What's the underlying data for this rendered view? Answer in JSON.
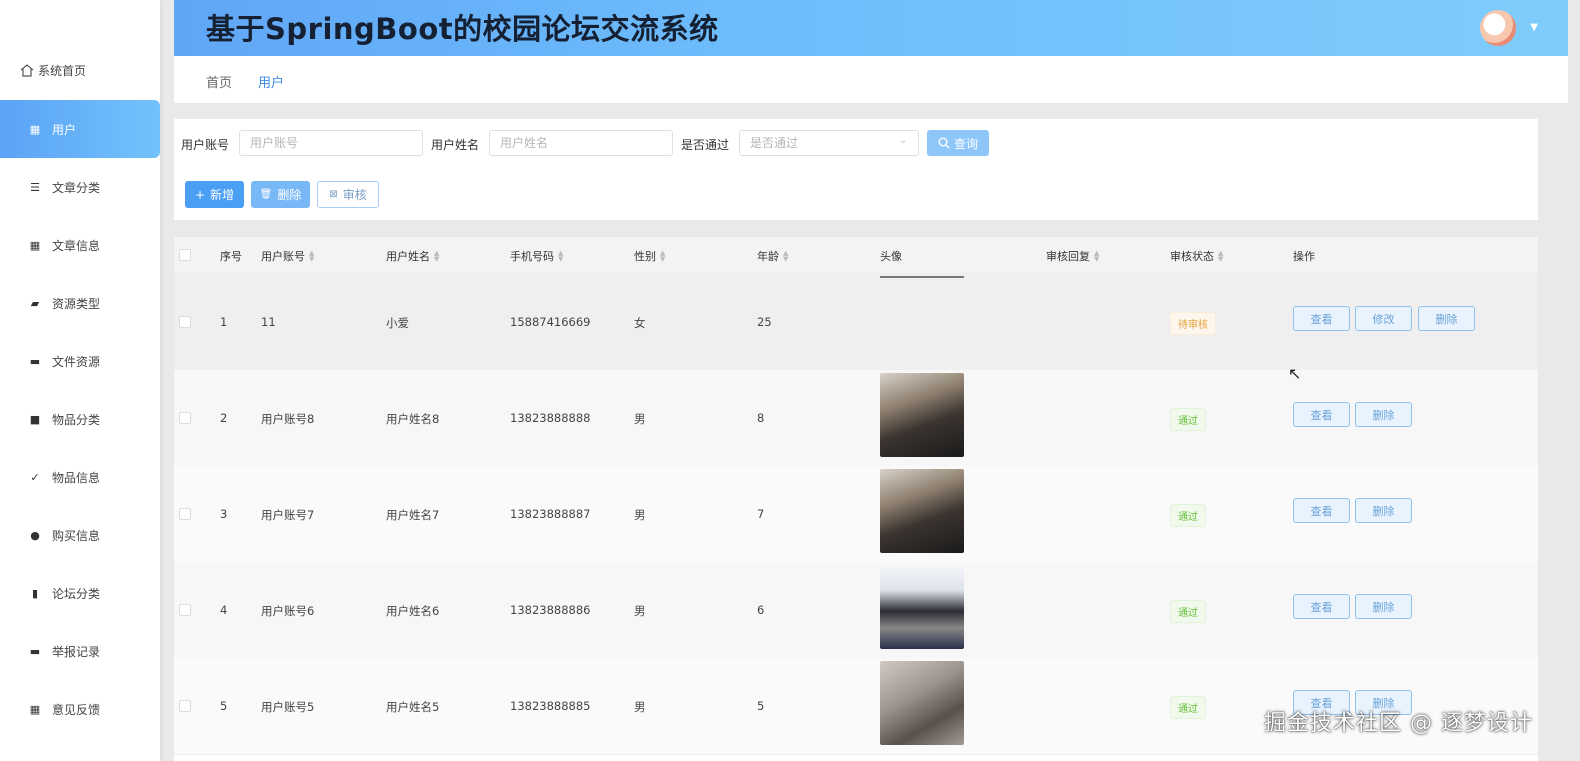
{
  "header": {
    "title": "基于SpringBoot的校园论坛交流系统"
  },
  "sidebar": {
    "home": "系统首页",
    "items": [
      {
        "label": "用户",
        "icon": "grid-icon"
      },
      {
        "label": "文章分类",
        "icon": "list-icon"
      },
      {
        "label": "文章信息",
        "icon": "grid-icon"
      },
      {
        "label": "资源类型",
        "icon": "wallet-icon"
      },
      {
        "label": "文件资源",
        "icon": "monitor-icon"
      },
      {
        "label": "物品分类",
        "icon": "message-icon"
      },
      {
        "label": "物品信息",
        "icon": "clipboard-icon"
      },
      {
        "label": "购买信息",
        "icon": "user-icon"
      },
      {
        "label": "论坛分类",
        "icon": "bar-chart-icon"
      },
      {
        "label": "举报记录",
        "icon": "monitor-icon"
      },
      {
        "label": "意见反馈",
        "icon": "grid-icon"
      }
    ]
  },
  "breadcrumb": {
    "home": "首页",
    "current": "用户"
  },
  "filters": {
    "account_label": "用户账号",
    "account_placeholder": "用户账号",
    "name_label": "用户姓名",
    "name_placeholder": "用户姓名",
    "pass_label": "是否通过",
    "pass_placeholder": "是否通过",
    "query": "查询"
  },
  "actions": {
    "add": "新增",
    "delete": "删除",
    "audit": "审核"
  },
  "table": {
    "headers": [
      "序号",
      "用户账号",
      "用户姓名",
      "手机号码",
      "性别",
      "年龄",
      "头像",
      "审核回复",
      "审核状态",
      "操作"
    ],
    "rows": [
      {
        "idx": "1",
        "account": "11",
        "name": "小爱",
        "phone": "15887416669",
        "gender": "女",
        "age": "25",
        "status": "待审核",
        "btns": [
          "查看",
          "修改",
          "删除"
        ]
      },
      {
        "idx": "2",
        "account": "用户账号8",
        "name": "用户姓名8",
        "phone": "13823888888",
        "gender": "男",
        "age": "8",
        "status": "通过",
        "btns": [
          "查看",
          "删除"
        ]
      },
      {
        "idx": "3",
        "account": "用户账号7",
        "name": "用户姓名7",
        "phone": "13823888887",
        "gender": "男",
        "age": "7",
        "status": "通过",
        "btns": [
          "查看",
          "删除"
        ]
      },
      {
        "idx": "4",
        "account": "用户账号6",
        "name": "用户姓名6",
        "phone": "13823888886",
        "gender": "男",
        "age": "6",
        "status": "通过",
        "btns": [
          "查看",
          "删除"
        ]
      },
      {
        "idx": "5",
        "account": "用户账号5",
        "name": "用户姓名5",
        "phone": "13823888885",
        "gender": "男",
        "age": "5",
        "status": "通过",
        "btns": [
          "查看",
          "删除"
        ]
      }
    ]
  },
  "watermark": "掘金技术社区 @ 逐梦设计",
  "colors": {
    "accent": "#4a9ff5",
    "pass": "#67c23a",
    "wait": "#e6a23c"
  }
}
